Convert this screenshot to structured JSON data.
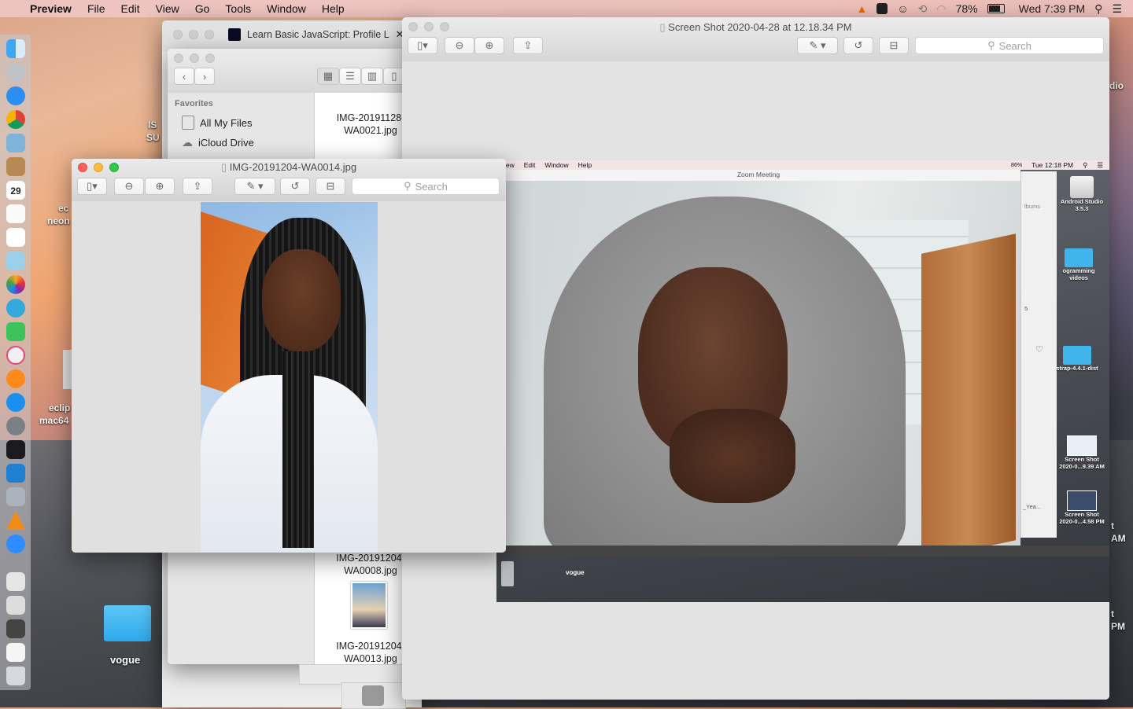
{
  "menubar": {
    "app": "Preview",
    "items": [
      "File",
      "Edit",
      "View",
      "Go",
      "Tools",
      "Window",
      "Help"
    ],
    "battery": "78%",
    "clock": "Wed 7:39 PM"
  },
  "desktop": {
    "left_labels": [
      "IS",
      "SU",
      "ec",
      "neon",
      "eclip",
      "mac64"
    ],
    "vogue_label": "vogue",
    "right_labels": [
      "dio",
      "t",
      "AM",
      "t",
      "PM"
    ]
  },
  "browser_window": {
    "tab_title": "Learn Basic JavaScript: Profile L"
  },
  "finder": {
    "favorites_header": "Favorites",
    "sidebar": [
      "All My Files",
      "iCloud Drive"
    ],
    "files": [
      {
        "line1": "IMG-20191128-",
        "line2": "WA0021.jpg"
      },
      {
        "line1": "IMG-20191204-",
        "line2": "WA0008.jpg"
      },
      {
        "line1": "IMG-20191204-",
        "line2": "WA0013.jpg"
      }
    ]
  },
  "preview_back": {
    "title": "Screen Shot 2020-04-28 at 12.18.34 PM",
    "search_placeholder": "Search",
    "inner": {
      "menu": [
        "iew",
        "Edit",
        "Window",
        "Help"
      ],
      "battery": "86%",
      "clock": "Tue 12:18 PM",
      "zoom_title": "Zoom Meeting",
      "albums": "lbums",
      "five": "5",
      "years": "_Yea...",
      "vogue": "vogue",
      "desk_items": [
        {
          "name": "Android Studio 3.5.3"
        },
        {
          "name": "ogramming videos"
        },
        {
          "name": "strap-4.4.1-dist"
        },
        {
          "name": "Screen Shot 2020-0...9.39 AM"
        },
        {
          "name": "Screen Shot 2020-0...4.58 PM"
        }
      ]
    }
  },
  "preview_front": {
    "title": "IMG-20191204-WA0014.jpg",
    "search_placeholder": "Search"
  }
}
